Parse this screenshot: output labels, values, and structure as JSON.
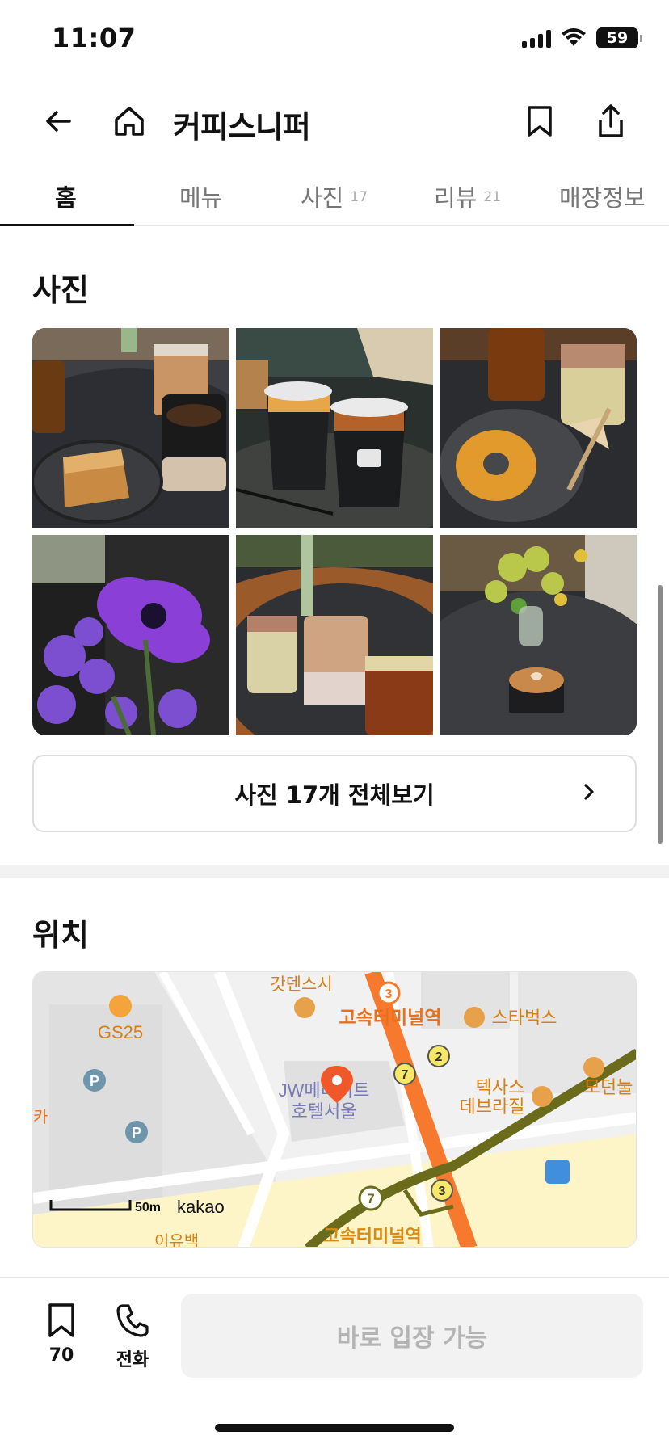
{
  "status": {
    "time": "11:07",
    "battery": "59",
    "battery_level": 0.59
  },
  "header": {
    "title": "커피스니퍼"
  },
  "tabs": [
    {
      "label": "홈",
      "count": ""
    },
    {
      "label": "메뉴",
      "count": ""
    },
    {
      "label": "사진",
      "count": "17"
    },
    {
      "label": "리뷰",
      "count": "21"
    },
    {
      "label": "매장정보",
      "count": ""
    }
  ],
  "photos": {
    "title": "사진",
    "all_button": "사진 17개 전체보기",
    "thumbnails": [
      "iced-coffee-and-cake",
      "takeout-cups",
      "coffee-and-donut",
      "purple-flowers",
      "iced-lattes",
      "latte-art-with-flowers"
    ]
  },
  "location": {
    "title": "위치",
    "map_labels": {
      "gs25": "GS25",
      "gatden": "갓덴스시",
      "terminal_top": "고속터미널역",
      "starbucks": "스타벅스",
      "jw": "JW메리어트",
      "jw2": "호텔서울",
      "texas": "텍사스",
      "texas2": "데브라질",
      "modern": "모던눌",
      "terminal_bottom": "고속터미널역",
      "scale": "50m",
      "kakao": "kakao",
      "line3a": "3",
      "line2": "2",
      "line7a": "7",
      "line7b": "7",
      "line3b": "3",
      "p": "P",
      "truncated": "이유백",
      "edge": "카"
    }
  },
  "bottom": {
    "save_count": "70",
    "call_label": "전화",
    "enter_label": "바로 입장 가능"
  },
  "colors": {
    "accent": "#111111",
    "subway_line3": "#f7792e",
    "subway_line7": "#6b6b1c",
    "poi_orange": "#e08a18"
  }
}
